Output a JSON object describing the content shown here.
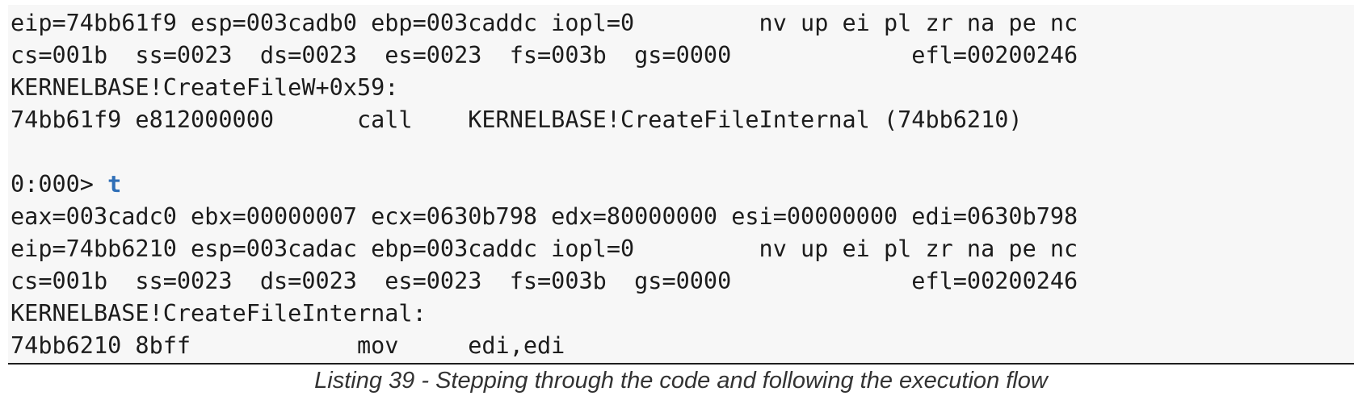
{
  "listing": {
    "lines": [
      "eip=74bb61f9 esp=003cadb0 ebp=003caddc iopl=0         nv up ei pl zr na pe nc",
      "cs=001b  ss=0023  ds=0023  es=0023  fs=003b  gs=0000             efl=00200246",
      "KERNELBASE!CreateFileW+0x59:",
      "74bb61f9 e812000000      call    KERNELBASE!CreateFileInternal (74bb6210)",
      "",
      "eax=003cadc0 ebx=00000007 ecx=0630b798 edx=80000000 esi=00000000 edi=0630b798",
      "eip=74bb6210 esp=003cadac ebp=003caddc iopl=0         nv up ei pl zr na pe nc",
      "cs=001b  ss=0023  ds=0023  es=0023  fs=003b  gs=0000             efl=00200246",
      "KERNELBASE!CreateFileInternal:",
      "74bb6210 8bff            mov     edi,edi"
    ],
    "prompt": "0:000> ",
    "command": "t"
  },
  "caption": "Listing 39 - Stepping through the code and following the execution flow",
  "colors": {
    "command": "#2f6fb7",
    "code_text": "#1c1c1c",
    "box_background": "#f7f7f7"
  }
}
